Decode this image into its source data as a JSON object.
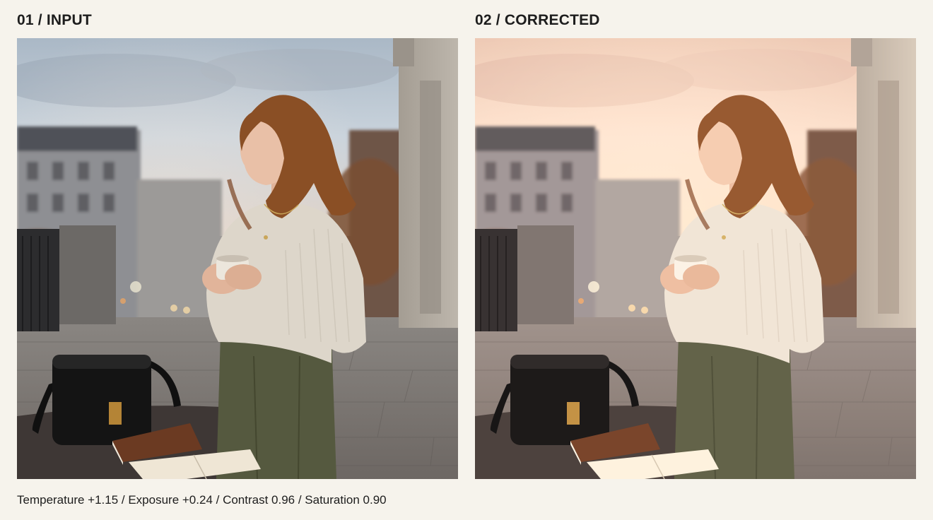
{
  "panels": {
    "input": {
      "title": "01 / INPUT",
      "image_subject": "woman-on-balcony-photo"
    },
    "corrected": {
      "title": "02 / CORRECTED",
      "image_subject": "woman-on-balcony-photo"
    }
  },
  "caption": "Temperature +1.15 / Exposure +0.24 / Contrast 0.96 / Saturation 0.90",
  "colors": {
    "page_background": "#f6f3ec",
    "text": "#1d1d1d",
    "input_sky": "#c9d4de",
    "corrected_sky": "#f4c9b0",
    "sweater": "#ddd5c8",
    "trousers": "#555a43",
    "hair": "#8b4f25",
    "bag": "#141414"
  }
}
